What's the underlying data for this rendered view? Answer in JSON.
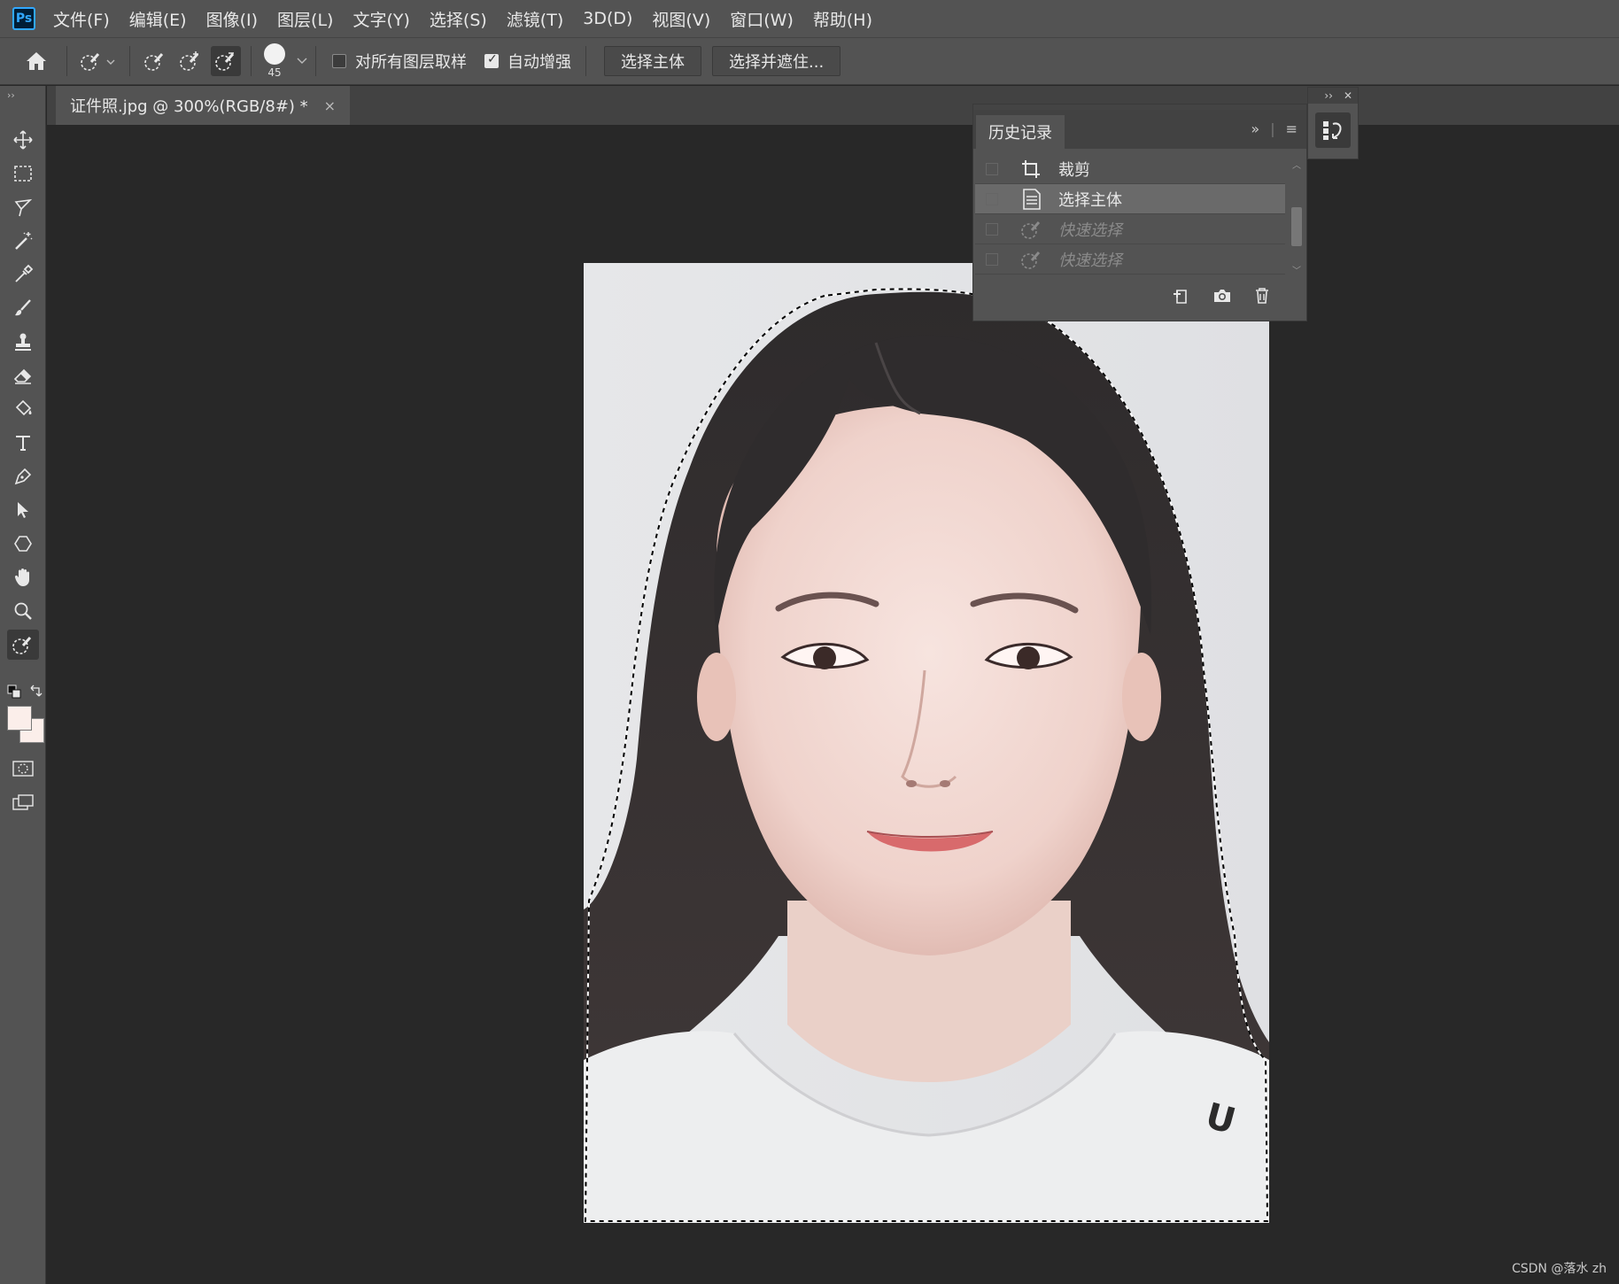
{
  "app": {
    "logo": "Ps"
  },
  "menu": [
    "文件(F)",
    "编辑(E)",
    "图像(I)",
    "图层(L)",
    "文字(Y)",
    "选择(S)",
    "滤镜(T)",
    "3D(D)",
    "视图(V)",
    "窗口(W)",
    "帮助(H)"
  ],
  "options": {
    "brush_size": "45",
    "sample_all_layers_label": "对所有图层取样",
    "sample_all_layers_checked": false,
    "auto_enhance_label": "自动增强",
    "auto_enhance_checked": true,
    "select_subject_button": "选择主体",
    "select_and_mask_button": "选择并遮住..."
  },
  "document": {
    "tab_title": "证件照.jpg @ 300%(RGB/8#) *",
    "close_glyph": "×"
  },
  "history_panel": {
    "title": "历史记录",
    "items": [
      {
        "label": "裁剪",
        "icon": "crop-icon",
        "state": "normal"
      },
      {
        "label": "选择主体",
        "icon": "document-icon",
        "state": "selected"
      },
      {
        "label": "快速选择",
        "icon": "quick-selection-icon",
        "state": "dimmed"
      },
      {
        "label": "快速选择",
        "icon": "quick-selection-icon",
        "state": "dimmed"
      }
    ],
    "footer_icons": [
      "new-document-from-state-icon",
      "camera-snapshot-icon",
      "trash-icon"
    ]
  },
  "tools": [
    "move-icon",
    "marquee-icon",
    "lasso-icon",
    "magic-wand-icon",
    "eyedropper-icon",
    "brush-icon",
    "stamp-icon",
    "eraser-icon",
    "paint-bucket-icon",
    "type-icon",
    "pen-icon",
    "path-selection-icon",
    "shape-icon",
    "hand-icon",
    "zoom-icon",
    "quick-selection-icon"
  ],
  "colors": {
    "foreground": "#fbeeea",
    "background": "#fbeeea",
    "accent": "#31a8ff"
  },
  "watermark": "CSDN @落水 zh"
}
